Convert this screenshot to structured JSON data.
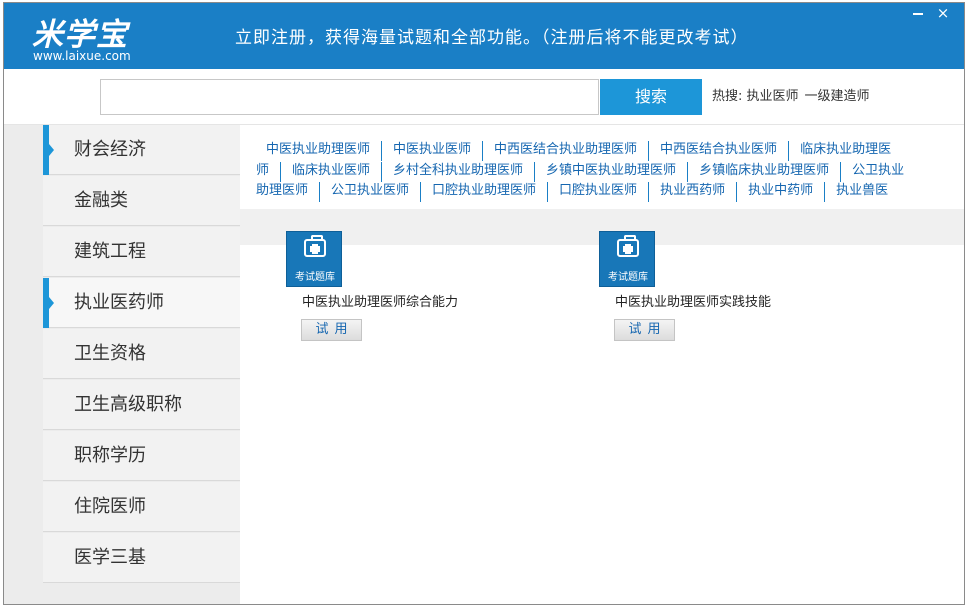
{
  "header": {
    "logo_text": "米学宝",
    "logo_url": "www.laixue.com",
    "message": "立即注册，获得海量试题和全部功能。（注册后将不能更改考试）",
    "minimize_label": "",
    "close_label": "×"
  },
  "search": {
    "value": "",
    "placeholder": "",
    "button_label": "搜索",
    "hot_label": "热搜:",
    "hot_items": [
      "执业医师",
      "一级建造师"
    ]
  },
  "sidebar": {
    "items": [
      {
        "label": "财会经济",
        "active": true
      },
      {
        "label": "金融类",
        "active": false
      },
      {
        "label": "建筑工程",
        "active": false
      },
      {
        "label": "执业医药师",
        "active": true
      },
      {
        "label": "卫生资格",
        "active": false
      },
      {
        "label": "卫生高级职称",
        "active": false
      },
      {
        "label": "职称学历",
        "active": false
      },
      {
        "label": "住院医师",
        "active": false
      },
      {
        "label": "医学三基",
        "active": false
      }
    ]
  },
  "tags": {
    "line1": [
      "中医执业助理医师",
      "中医执业医师",
      "中西医结合执业助理医师",
      "中西医结合执业医师",
      "临床执业助理医"
    ],
    "line2": [
      "师",
      "临床执业医师",
      "乡村全科执业助理医师",
      "乡镇中医执业助理医师",
      "乡镇临床执业助理医师",
      "公卫执业"
    ],
    "line3": [
      "助理医师",
      "公卫执业医师",
      "口腔执业助理医师",
      "口腔执业医师",
      "执业西药师",
      "执业中药师",
      "执业兽医"
    ]
  },
  "cards": [
    {
      "icon_caption": "考试题库",
      "title": "中医执业助理医师综合能力",
      "button_label": "试用"
    },
    {
      "icon_caption": "考试题库",
      "title": "中医执业助理医师实践技能",
      "button_label": "试用"
    }
  ],
  "colors": {
    "header_bg": "#1a7fc6",
    "accent": "#1d96d8",
    "link": "#1566b0"
  }
}
